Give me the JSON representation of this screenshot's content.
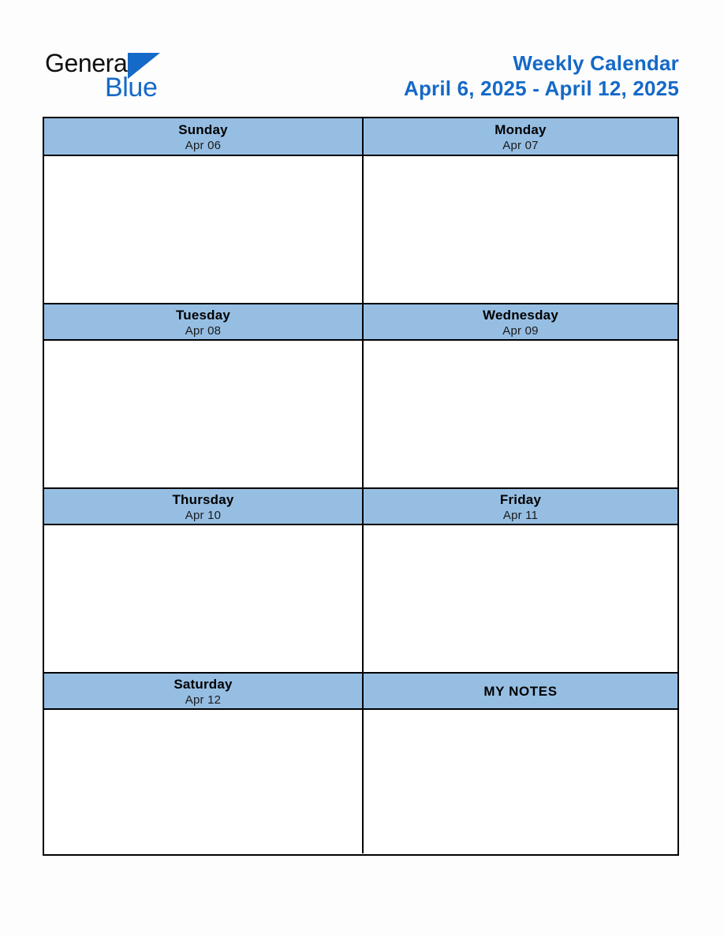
{
  "brand": {
    "name_part1": "General",
    "name_part2": "Blue",
    "triangle_color": "#1569c7",
    "text_color_dark": "#111111"
  },
  "header": {
    "title": "Weekly Calendar",
    "date_range": "April 6, 2025 - April 12, 2025",
    "title_color": "#1569c7"
  },
  "theme": {
    "header_cell_background": "#96bee3",
    "border_color": "#000000",
    "page_background": "#fdfdfd",
    "cell_background": "#ffffff"
  },
  "calendar": {
    "rows": [
      {
        "left": {
          "day": "Sunday",
          "date": "Apr 06",
          "notes": ""
        },
        "right": {
          "day": "Monday",
          "date": "Apr 07",
          "notes": ""
        }
      },
      {
        "left": {
          "day": "Tuesday",
          "date": "Apr 08",
          "notes": ""
        },
        "right": {
          "day": "Wednesday",
          "date": "Apr 09",
          "notes": ""
        }
      },
      {
        "left": {
          "day": "Thursday",
          "date": "Apr 10",
          "notes": ""
        },
        "right": {
          "day": "Friday",
          "date": "Apr 11",
          "notes": ""
        }
      },
      {
        "left": {
          "day": "Saturday",
          "date": "Apr 12",
          "notes": ""
        },
        "right": {
          "day": "MY NOTES",
          "date": "",
          "notes": ""
        }
      }
    ]
  }
}
